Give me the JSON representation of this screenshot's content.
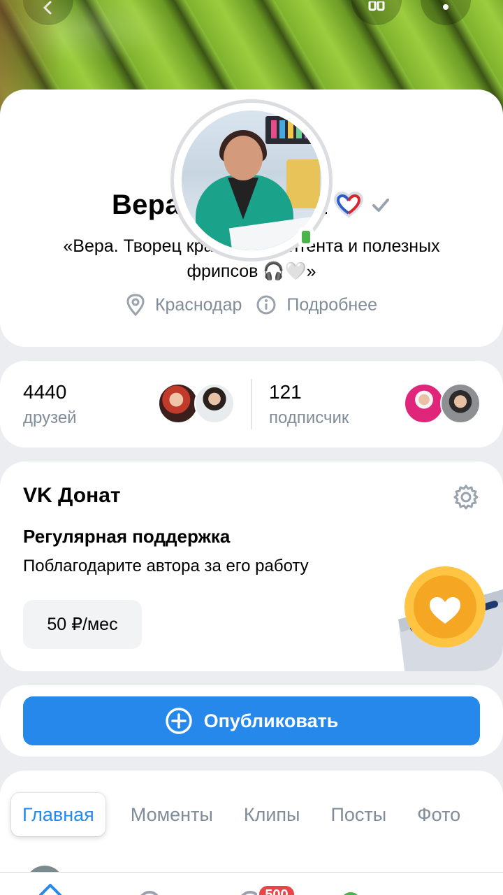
{
  "header": {
    "back_icon": "chevron-left-icon",
    "qr_icon": "qr-code-icon",
    "more_icon": "more-vertical-icon"
  },
  "profile": {
    "name": "Вера Деменева",
    "heart_emoji": "❤️",
    "verified_icon": "checkmark-icon",
    "online_icon": "mobile-online-icon",
    "bio": "«Вера. Творец красивого контента и полезных фрипсов 🎧🤍»",
    "city": "Краснодар",
    "details_label": "Подробнее"
  },
  "stats": {
    "friends_count": "4440",
    "friends_label": "друзей",
    "followers_count": "121",
    "followers_label": "подписчик"
  },
  "donut": {
    "title": "VK Донат",
    "subtitle": "Регулярная поддержка",
    "description": "Поблагодарите автора за его работу",
    "price": "50 ₽/мес",
    "settings_icon": "gear-icon"
  },
  "publish": {
    "label": "Опубликовать",
    "icon": "plus-circle-icon"
  },
  "tabs": [
    {
      "label": "Главная",
      "active": true
    },
    {
      "label": "Моменты",
      "active": false
    },
    {
      "label": "Клипы",
      "active": false
    },
    {
      "label": "Посты",
      "active": false
    },
    {
      "label": "Фото",
      "active": false
    }
  ],
  "bottom_nav": {
    "badge": "500"
  },
  "colors": {
    "accent": "#2688eb",
    "secondary_text": "#818c99",
    "background": "#ebedf0",
    "online": "#4bb34b",
    "badge": "#e64646"
  }
}
